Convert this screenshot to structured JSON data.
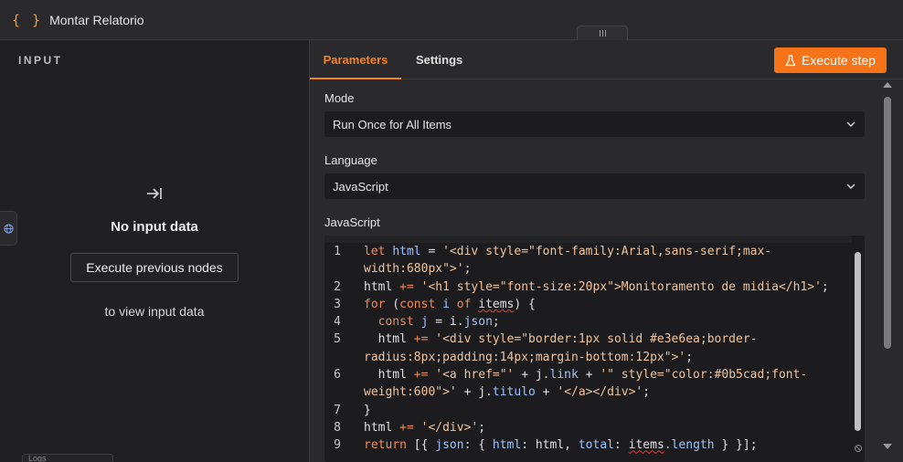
{
  "header": {
    "icon": "{ }",
    "title": "Montar Relatorio"
  },
  "input_panel": {
    "heading": "INPUT",
    "no_input": "No input data",
    "execute_previous": "Execute previous nodes",
    "view_text": "to view input data",
    "logs_label": "Logs"
  },
  "tabs": {
    "parameters": "Parameters",
    "settings": "Settings"
  },
  "execute_step": "Execute step",
  "fields": {
    "mode_label": "Mode",
    "mode_value": "Run Once for All Items",
    "language_label": "Language",
    "language_value": "JavaScript",
    "code_label": "JavaScript"
  },
  "code": [
    {
      "n": "1",
      "parts": [
        [
          "k",
          "let "
        ],
        [
          "v",
          "html"
        ],
        [
          "p",
          " = "
        ],
        [
          "s",
          "'<div style=\"font-family:Arial,sans-serif;max-width:680px\">'"
        ],
        [
          "p",
          ";"
        ]
      ]
    },
    {
      "n": "2",
      "parts": [
        [
          "p",
          "html "
        ],
        [
          "k",
          "+="
        ],
        [
          "p",
          " "
        ],
        [
          "s",
          "'<h1 style=\"font-size:20px\">Monitoramento de midia</h1>'"
        ],
        [
          "p",
          ";"
        ]
      ]
    },
    {
      "n": "3",
      "parts": [
        [
          "k",
          "for"
        ],
        [
          "p",
          " ("
        ],
        [
          "k",
          "const"
        ],
        [
          "p",
          " "
        ],
        [
          "v",
          "i"
        ],
        [
          "p",
          " "
        ],
        [
          "k",
          "of"
        ],
        [
          "p",
          " "
        ],
        [
          "sq",
          "items"
        ],
        [
          "p",
          ") {"
        ]
      ]
    },
    {
      "n": "4",
      "parts": [
        [
          "p",
          "  "
        ],
        [
          "k",
          "const"
        ],
        [
          "p",
          " "
        ],
        [
          "v",
          "j"
        ],
        [
          "p",
          " = i."
        ],
        [
          "v",
          "json"
        ],
        [
          "p",
          ";"
        ]
      ]
    },
    {
      "n": "5",
      "parts": [
        [
          "p",
          "  html "
        ],
        [
          "k",
          "+="
        ],
        [
          "p",
          " "
        ],
        [
          "s",
          "'<div style=\"border:1px solid #e3e6ea;border-radius:8px;padding:14px;margin-bottom:12px\">'"
        ],
        [
          "p",
          ";"
        ]
      ]
    },
    {
      "n": "6",
      "parts": [
        [
          "p",
          "  html "
        ],
        [
          "k",
          "+="
        ],
        [
          "p",
          " "
        ],
        [
          "s",
          "'<a href=\"'"
        ],
        [
          "p",
          " + j."
        ],
        [
          "v",
          "link"
        ],
        [
          "p",
          " + "
        ],
        [
          "s",
          "'\" style=\"color:#0b5cad;font-weight:600\">'"
        ],
        [
          "p",
          " + j."
        ],
        [
          "v",
          "titulo"
        ],
        [
          "p",
          " + "
        ],
        [
          "s",
          "'</a></div>'"
        ],
        [
          "p",
          ";"
        ]
      ]
    },
    {
      "n": "7",
      "parts": [
        [
          "p",
          "}"
        ]
      ]
    },
    {
      "n": "8",
      "parts": [
        [
          "p",
          "html "
        ],
        [
          "k",
          "+="
        ],
        [
          "p",
          " "
        ],
        [
          "s",
          "'</div>'"
        ],
        [
          "p",
          ";"
        ]
      ]
    },
    {
      "n": "9",
      "parts": [
        [
          "k",
          "return"
        ],
        [
          "p",
          " [{ "
        ],
        [
          "v",
          "json"
        ],
        [
          "p",
          ": { "
        ],
        [
          "v",
          "html"
        ],
        [
          "p",
          ": html, "
        ],
        [
          "v",
          "total"
        ],
        [
          "p",
          ": "
        ],
        [
          "sq",
          "items"
        ],
        [
          "p",
          "."
        ],
        [
          "v",
          "length"
        ],
        [
          "p",
          " } }];"
        ]
      ]
    }
  ],
  "colors": {
    "accent": "#f7731a",
    "panel": "#2a2a2c",
    "editor": "#1c1c1e"
  }
}
